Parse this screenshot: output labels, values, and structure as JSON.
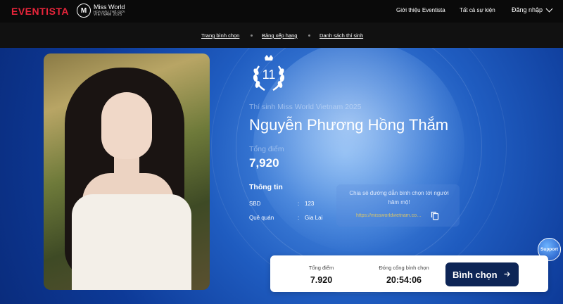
{
  "header": {
    "brand": "EVENTISTA",
    "event_logo": {
      "title": "Miss World",
      "subtitle": "HOA HẬU THẾ GIỚI",
      "subtitle2": "VIETNAM 2025"
    },
    "nav": {
      "about": "Giới thiệu Eventista",
      "all_events": "Tất cả sự kiện",
      "login": "Đăng nhập"
    }
  },
  "subnav": {
    "items": [
      "Trang bình chọn",
      "Bảng xếp hạng",
      "Danh sách thí sinh"
    ]
  },
  "contestant": {
    "rank": "11",
    "subtitle": "Thí sinh Miss World Vietnam 2025",
    "name": "Nguyễn Phương Hồng Thắm",
    "score_label": "Tổng điểm",
    "score": "7,920",
    "info_title": "Thông tin",
    "info": [
      {
        "label": "SBD",
        "value": "123"
      },
      {
        "label": "Quê quán",
        "value": "Gia Lai"
      }
    ]
  },
  "share": {
    "text": "Chia sẻ đường dẫn bình chọn tới người hâm mộ!",
    "link": "https://missworldvietnam.com/contestant",
    "copy_icon": "copy-icon"
  },
  "support_label": "Support",
  "vote_bar": {
    "total_label": "Tổng điểm",
    "total_value": "7.920",
    "close_label": "Đóng cổng bình chọn",
    "close_value": "20:54:06",
    "button_label": "Bình chọn"
  },
  "colors": {
    "brand_red": "#e8253b",
    "vote_button": "#0d2556",
    "link_gold": "#d8c46a"
  }
}
